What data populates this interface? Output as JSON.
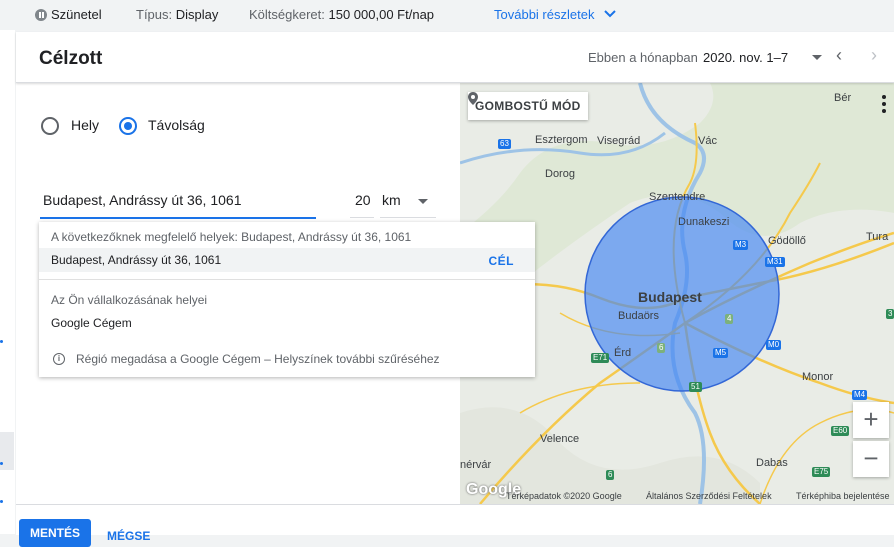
{
  "topbar": {
    "status": "Szünetel",
    "type_label": "Típus:",
    "type_value": "Display",
    "budget_label": "Költségkeret:",
    "budget_value": "150 000,00 Ft/nap",
    "more_details": "További részletek"
  },
  "header": {
    "title": "Célzott",
    "period_label": "Ebben a hónapban",
    "period_value": "2020. nov. 1–7"
  },
  "location": {
    "options": [
      "Hely",
      "Távolság"
    ],
    "selected": "Távolság",
    "address_value": "Budapest, Andrássy út 36, 1061",
    "radius_value": "20",
    "unit_value": "km"
  },
  "suggestions": {
    "matches_header": "A következőknek megfelelő helyek: Budapest, Andrássy út 36, 1061",
    "match_item": "Budapest, Andrássy út 36, 1061",
    "target_action": "CÉL",
    "business_header": "Az Ön vállalkozásának helyei",
    "business_item": "Google Cégem",
    "info_text": "Régió megadása a Google Cégem – Helyszínek további szűréséhez"
  },
  "map": {
    "pin_mode_button": "GOMBOSTŰ MÓD",
    "zoom_in": "+",
    "zoom_out": "−",
    "logo": "Google",
    "attribution": "Térképadatok ©2020 Google",
    "terms": "Általános Szerződési Feltételek",
    "report": "Térképhiba bejelentése",
    "center_city": "Budapest",
    "places": {
      "esztergom": "Esztergom",
      "visegrad": "Visegrád",
      "vac": "Vác",
      "ber": "Bér",
      "dorog": "Dorog",
      "szentendre": "Szentendre",
      "dunakeszi": "Dunakeszi",
      "godollo": "Gödöllő",
      "tura": "Tura",
      "budaors": "Budaörs",
      "erd": "Érd",
      "monor": "Monor",
      "velence": "Velence",
      "dabas": "Dabas",
      "szekesfehervar": "nérvár"
    },
    "roads": [
      "63",
      "M3",
      "M31",
      "4",
      "6",
      "M5",
      "M0",
      "E71",
      "51",
      "M4",
      "E60",
      "E75",
      "6",
      "3"
    ]
  },
  "actions": {
    "save": "MENTÉS",
    "cancel": "MÉGSE"
  },
  "colors": {
    "accent": "#1a73e8",
    "radius_fill": "#4285f4",
    "road_green": "#2e8b57"
  }
}
